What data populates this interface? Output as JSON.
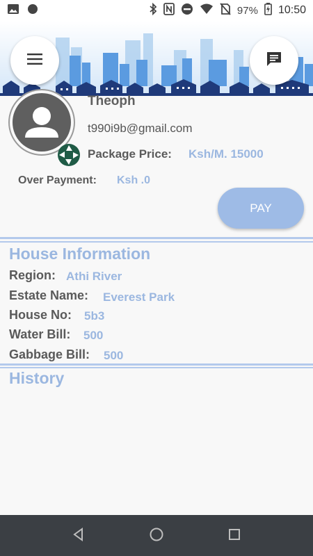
{
  "status_bar": {
    "battery_percent": "97%",
    "time": "10:50",
    "icons": [
      "image-icon",
      "circle-icon",
      "bluetooth-icon",
      "nfc-icon",
      "do-not-disturb-icon",
      "wifi-icon",
      "no-sim-icon",
      "battery-charging-icon"
    ]
  },
  "header": {
    "menu_icon": "hamburger-menu-icon",
    "chat_icon": "chat-icon",
    "banner_colors": {
      "sky": "#d4e6f8",
      "buildings": "#3d6fb8",
      "houses": "#1f3a7a"
    }
  },
  "profile": {
    "name": "Theoph",
    "email": "t990i9b@gmail.com",
    "package_price_label": "Package Price:",
    "package_price_value": "Ksh/M. 15000",
    "over_payment_label": "Over Payment:",
    "over_payment_value": "Ksh .0",
    "pay_button": "PAY"
  },
  "house_information": {
    "title": "House Information",
    "rows": [
      {
        "label": "Region:",
        "value": "Athi River"
      },
      {
        "label": "Estate Name:",
        "value": "Everest Park"
      },
      {
        "label": "House No:",
        "value": "5b3"
      },
      {
        "label": "Water Bill:",
        "value": "500"
      },
      {
        "label": "Gabbage Bill:",
        "value": "500"
      }
    ]
  },
  "history": {
    "title": "History"
  },
  "colors": {
    "accent": "#9bb7e0",
    "divider": "#b3c9ec",
    "nav_bar": "#3b3f44"
  }
}
